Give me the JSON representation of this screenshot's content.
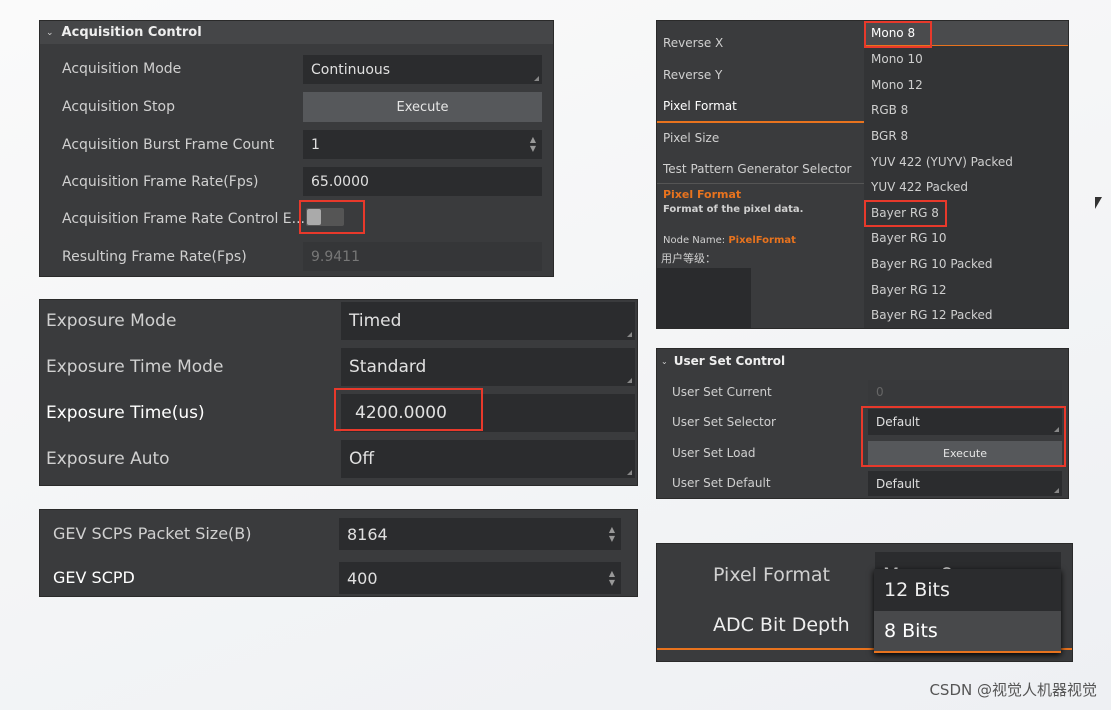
{
  "acquisition": {
    "title": "Acquisition Control",
    "rows": [
      {
        "label": "Acquisition Mode",
        "value": "Continuous"
      },
      {
        "label": "Acquisition Stop",
        "value": "Execute"
      },
      {
        "label": "Acquisition Burst Frame Count",
        "value": "1"
      },
      {
        "label": "Acquisition Frame Rate(Fps)",
        "value": "65.0000"
      },
      {
        "label": "Acquisition Frame Rate Control E...",
        "value": "off"
      },
      {
        "label": "Resulting Frame Rate(Fps)",
        "value": "9.9411"
      }
    ]
  },
  "exposure": {
    "rows": [
      {
        "label": "Exposure Mode",
        "value": "Timed"
      },
      {
        "label": "Exposure Time Mode",
        "value": "Standard"
      },
      {
        "label": "Exposure Time(us)",
        "value": "4200.0000"
      },
      {
        "label": "Exposure Auto",
        "value": "Off"
      }
    ]
  },
  "gev": {
    "rows": [
      {
        "label": "GEV SCPS Packet Size(B)",
        "value": "8164"
      },
      {
        "label": "GEV SCPD",
        "value": "400"
      }
    ]
  },
  "pixel": {
    "left": [
      "Reverse X",
      "Reverse Y",
      "Pixel Format",
      "Pixel Size",
      "Test Pattern Generator Selector"
    ],
    "desc_title": "Pixel Format",
    "desc_text": "Format of the pixel data.",
    "node_label": "Node Name: ",
    "node_value": "PixelFormat",
    "user_level": "用户等级：",
    "options": [
      "Mono 8",
      "Mono 10",
      "Mono 12",
      "RGB 8",
      "BGR 8",
      "YUV 422 (YUYV) Packed",
      "YUV 422 Packed",
      "Bayer RG 8",
      "Bayer RG 10",
      "Bayer RG 10 Packed",
      "Bayer RG 12",
      "Bayer RG 12 Packed"
    ]
  },
  "userset": {
    "title": "User Set Control",
    "rows": [
      {
        "label": "User Set Current",
        "value": "0"
      },
      {
        "label": "User Set Selector",
        "value": "Default"
      },
      {
        "label": "User Set Load",
        "value": "Execute"
      },
      {
        "label": "User Set Default",
        "value": "Default"
      }
    ]
  },
  "adc": {
    "pixel_label": "Pixel Format",
    "pixel_value": "Mono 8",
    "adc_label": "ADC Bit Depth",
    "options": [
      "12 Bits",
      "8 Bits"
    ]
  },
  "watermark": "CSDN @视觉人机器视觉",
  "colors": {
    "accent": "#e8731e",
    "highlight": "#e8392b"
  }
}
